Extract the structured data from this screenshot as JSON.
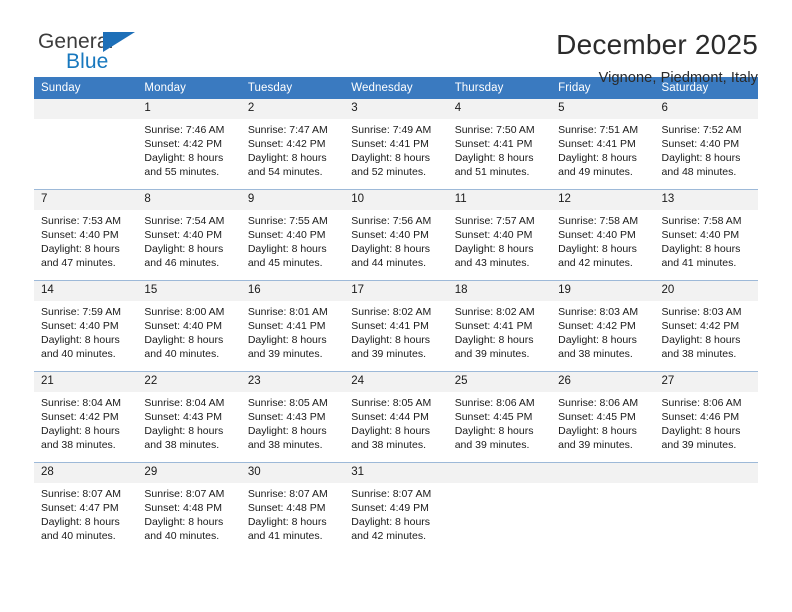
{
  "brand": {
    "word_one": "General",
    "word_two": "Blue",
    "accent_color": "#1d6fb8"
  },
  "header": {
    "month_title": "December 2025",
    "location": "Vignone, Piedmont, Italy"
  },
  "calendar": {
    "header_bg": "#3a7ac0",
    "daynum_bg": "#f2f2f2",
    "weekday_headers": [
      "Sunday",
      "Monday",
      "Tuesday",
      "Wednesday",
      "Thursday",
      "Friday",
      "Saturday"
    ],
    "weeks": [
      [
        {
          "day": "",
          "sunrise": "",
          "sunset": "",
          "daylight_1": "",
          "daylight_2": ""
        },
        {
          "day": "1",
          "sunrise": "Sunrise: 7:46 AM",
          "sunset": "Sunset: 4:42 PM",
          "daylight_1": "Daylight: 8 hours",
          "daylight_2": "and 55 minutes."
        },
        {
          "day": "2",
          "sunrise": "Sunrise: 7:47 AM",
          "sunset": "Sunset: 4:42 PM",
          "daylight_1": "Daylight: 8 hours",
          "daylight_2": "and 54 minutes."
        },
        {
          "day": "3",
          "sunrise": "Sunrise: 7:49 AM",
          "sunset": "Sunset: 4:41 PM",
          "daylight_1": "Daylight: 8 hours",
          "daylight_2": "and 52 minutes."
        },
        {
          "day": "4",
          "sunrise": "Sunrise: 7:50 AM",
          "sunset": "Sunset: 4:41 PM",
          "daylight_1": "Daylight: 8 hours",
          "daylight_2": "and 51 minutes."
        },
        {
          "day": "5",
          "sunrise": "Sunrise: 7:51 AM",
          "sunset": "Sunset: 4:41 PM",
          "daylight_1": "Daylight: 8 hours",
          "daylight_2": "and 49 minutes."
        },
        {
          "day": "6",
          "sunrise": "Sunrise: 7:52 AM",
          "sunset": "Sunset: 4:40 PM",
          "daylight_1": "Daylight: 8 hours",
          "daylight_2": "and 48 minutes."
        }
      ],
      [
        {
          "day": "7",
          "sunrise": "Sunrise: 7:53 AM",
          "sunset": "Sunset: 4:40 PM",
          "daylight_1": "Daylight: 8 hours",
          "daylight_2": "and 47 minutes."
        },
        {
          "day": "8",
          "sunrise": "Sunrise: 7:54 AM",
          "sunset": "Sunset: 4:40 PM",
          "daylight_1": "Daylight: 8 hours",
          "daylight_2": "and 46 minutes."
        },
        {
          "day": "9",
          "sunrise": "Sunrise: 7:55 AM",
          "sunset": "Sunset: 4:40 PM",
          "daylight_1": "Daylight: 8 hours",
          "daylight_2": "and 45 minutes."
        },
        {
          "day": "10",
          "sunrise": "Sunrise: 7:56 AM",
          "sunset": "Sunset: 4:40 PM",
          "daylight_1": "Daylight: 8 hours",
          "daylight_2": "and 44 minutes."
        },
        {
          "day": "11",
          "sunrise": "Sunrise: 7:57 AM",
          "sunset": "Sunset: 4:40 PM",
          "daylight_1": "Daylight: 8 hours",
          "daylight_2": "and 43 minutes."
        },
        {
          "day": "12",
          "sunrise": "Sunrise: 7:58 AM",
          "sunset": "Sunset: 4:40 PM",
          "daylight_1": "Daylight: 8 hours",
          "daylight_2": "and 42 minutes."
        },
        {
          "day": "13",
          "sunrise": "Sunrise: 7:58 AM",
          "sunset": "Sunset: 4:40 PM",
          "daylight_1": "Daylight: 8 hours",
          "daylight_2": "and 41 minutes."
        }
      ],
      [
        {
          "day": "14",
          "sunrise": "Sunrise: 7:59 AM",
          "sunset": "Sunset: 4:40 PM",
          "daylight_1": "Daylight: 8 hours",
          "daylight_2": "and 40 minutes."
        },
        {
          "day": "15",
          "sunrise": "Sunrise: 8:00 AM",
          "sunset": "Sunset: 4:40 PM",
          "daylight_1": "Daylight: 8 hours",
          "daylight_2": "and 40 minutes."
        },
        {
          "day": "16",
          "sunrise": "Sunrise: 8:01 AM",
          "sunset": "Sunset: 4:41 PM",
          "daylight_1": "Daylight: 8 hours",
          "daylight_2": "and 39 minutes."
        },
        {
          "day": "17",
          "sunrise": "Sunrise: 8:02 AM",
          "sunset": "Sunset: 4:41 PM",
          "daylight_1": "Daylight: 8 hours",
          "daylight_2": "and 39 minutes."
        },
        {
          "day": "18",
          "sunrise": "Sunrise: 8:02 AM",
          "sunset": "Sunset: 4:41 PM",
          "daylight_1": "Daylight: 8 hours",
          "daylight_2": "and 39 minutes."
        },
        {
          "day": "19",
          "sunrise": "Sunrise: 8:03 AM",
          "sunset": "Sunset: 4:42 PM",
          "daylight_1": "Daylight: 8 hours",
          "daylight_2": "and 38 minutes."
        },
        {
          "day": "20",
          "sunrise": "Sunrise: 8:03 AM",
          "sunset": "Sunset: 4:42 PM",
          "daylight_1": "Daylight: 8 hours",
          "daylight_2": "and 38 minutes."
        }
      ],
      [
        {
          "day": "21",
          "sunrise": "Sunrise: 8:04 AM",
          "sunset": "Sunset: 4:42 PM",
          "daylight_1": "Daylight: 8 hours",
          "daylight_2": "and 38 minutes."
        },
        {
          "day": "22",
          "sunrise": "Sunrise: 8:04 AM",
          "sunset": "Sunset: 4:43 PM",
          "daylight_1": "Daylight: 8 hours",
          "daylight_2": "and 38 minutes."
        },
        {
          "day": "23",
          "sunrise": "Sunrise: 8:05 AM",
          "sunset": "Sunset: 4:43 PM",
          "daylight_1": "Daylight: 8 hours",
          "daylight_2": "and 38 minutes."
        },
        {
          "day": "24",
          "sunrise": "Sunrise: 8:05 AM",
          "sunset": "Sunset: 4:44 PM",
          "daylight_1": "Daylight: 8 hours",
          "daylight_2": "and 38 minutes."
        },
        {
          "day": "25",
          "sunrise": "Sunrise: 8:06 AM",
          "sunset": "Sunset: 4:45 PM",
          "daylight_1": "Daylight: 8 hours",
          "daylight_2": "and 39 minutes."
        },
        {
          "day": "26",
          "sunrise": "Sunrise: 8:06 AM",
          "sunset": "Sunset: 4:45 PM",
          "daylight_1": "Daylight: 8 hours",
          "daylight_2": "and 39 minutes."
        },
        {
          "day": "27",
          "sunrise": "Sunrise: 8:06 AM",
          "sunset": "Sunset: 4:46 PM",
          "daylight_1": "Daylight: 8 hours",
          "daylight_2": "and 39 minutes."
        }
      ],
      [
        {
          "day": "28",
          "sunrise": "Sunrise: 8:07 AM",
          "sunset": "Sunset: 4:47 PM",
          "daylight_1": "Daylight: 8 hours",
          "daylight_2": "and 40 minutes."
        },
        {
          "day": "29",
          "sunrise": "Sunrise: 8:07 AM",
          "sunset": "Sunset: 4:48 PM",
          "daylight_1": "Daylight: 8 hours",
          "daylight_2": "and 40 minutes."
        },
        {
          "day": "30",
          "sunrise": "Sunrise: 8:07 AM",
          "sunset": "Sunset: 4:48 PM",
          "daylight_1": "Daylight: 8 hours",
          "daylight_2": "and 41 minutes."
        },
        {
          "day": "31",
          "sunrise": "Sunrise: 8:07 AM",
          "sunset": "Sunset: 4:49 PM",
          "daylight_1": "Daylight: 8 hours",
          "daylight_2": "and 42 minutes."
        },
        {
          "day": "",
          "sunrise": "",
          "sunset": "",
          "daylight_1": "",
          "daylight_2": ""
        },
        {
          "day": "",
          "sunrise": "",
          "sunset": "",
          "daylight_1": "",
          "daylight_2": ""
        },
        {
          "day": "",
          "sunrise": "",
          "sunset": "",
          "daylight_1": "",
          "daylight_2": ""
        }
      ]
    ]
  }
}
